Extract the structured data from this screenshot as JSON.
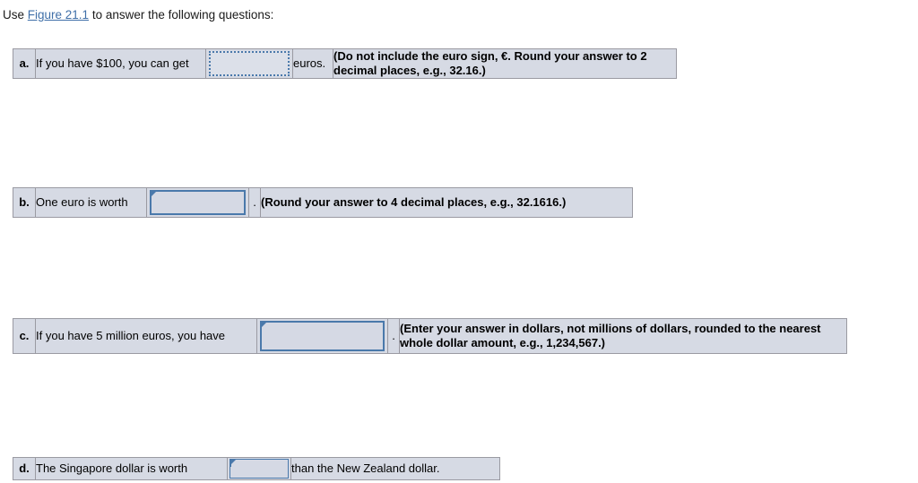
{
  "intro": {
    "prefix": "Use ",
    "link_label": "Figure 21.1",
    "suffix": " to answer the following questions:"
  },
  "colors": {
    "cell_background": "#d6dae4",
    "cell_border": "#9a9aa2",
    "hint_text": "#ee0000",
    "input_border": "#4a79ab",
    "link": "#3f6fa8"
  },
  "questions": [
    {
      "letter": "a.",
      "prompt": "If you have $100, you can get",
      "input_value": "",
      "input_style": "dotted",
      "tail": "euros.",
      "period": "",
      "hint": "(Do not include the euro sign, €. Round your answer to 2 decimal places, e.g., 32.16.)"
    },
    {
      "letter": "b.",
      "prompt": "One euro is worth",
      "input_value": "",
      "input_style": "solid",
      "tail": "",
      "period": ".",
      "hint": "(Round your answer to 4 decimal places, e.g., 32.1616.)"
    },
    {
      "letter": "c.",
      "prompt": "If you have 5 million euros, you have",
      "input_value": "",
      "input_style": "solid",
      "tail": "",
      "period": ".",
      "hint": "(Enter your answer in dollars, not millions of dollars, rounded to the nearest whole dollar amount, e.g., 1,234,567.)"
    },
    {
      "letter": "d.",
      "prompt": "The Singapore dollar is worth",
      "input_value": "",
      "input_style": "solid",
      "tail": "than the New Zealand dollar.",
      "period": "",
      "hint": ""
    }
  ]
}
